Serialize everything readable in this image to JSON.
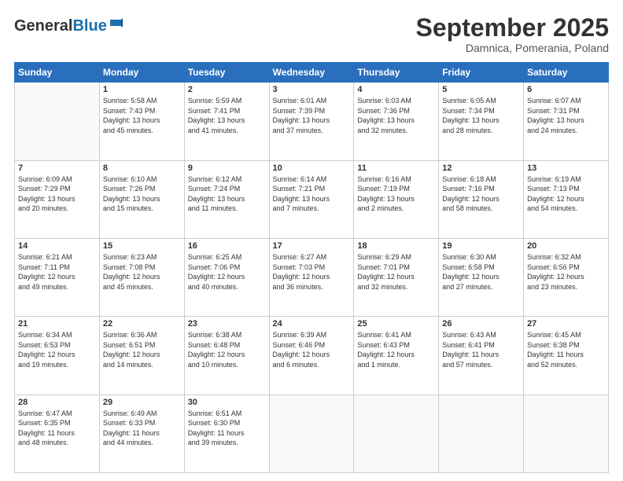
{
  "header": {
    "logo_general": "General",
    "logo_blue": "Blue",
    "month_title": "September 2025",
    "location": "Damnica, Pomerania, Poland"
  },
  "weekdays": [
    "Sunday",
    "Monday",
    "Tuesday",
    "Wednesday",
    "Thursday",
    "Friday",
    "Saturday"
  ],
  "weeks": [
    [
      {
        "day": "",
        "info": ""
      },
      {
        "day": "1",
        "info": "Sunrise: 5:58 AM\nSunset: 7:43 PM\nDaylight: 13 hours\nand 45 minutes."
      },
      {
        "day": "2",
        "info": "Sunrise: 5:59 AM\nSunset: 7:41 PM\nDaylight: 13 hours\nand 41 minutes."
      },
      {
        "day": "3",
        "info": "Sunrise: 6:01 AM\nSunset: 7:39 PM\nDaylight: 13 hours\nand 37 minutes."
      },
      {
        "day": "4",
        "info": "Sunrise: 6:03 AM\nSunset: 7:36 PM\nDaylight: 13 hours\nand 32 minutes."
      },
      {
        "day": "5",
        "info": "Sunrise: 6:05 AM\nSunset: 7:34 PM\nDaylight: 13 hours\nand 28 minutes."
      },
      {
        "day": "6",
        "info": "Sunrise: 6:07 AM\nSunset: 7:31 PM\nDaylight: 13 hours\nand 24 minutes."
      }
    ],
    [
      {
        "day": "7",
        "info": "Sunrise: 6:09 AM\nSunset: 7:29 PM\nDaylight: 13 hours\nand 20 minutes."
      },
      {
        "day": "8",
        "info": "Sunrise: 6:10 AM\nSunset: 7:26 PM\nDaylight: 13 hours\nand 15 minutes."
      },
      {
        "day": "9",
        "info": "Sunrise: 6:12 AM\nSunset: 7:24 PM\nDaylight: 13 hours\nand 11 minutes."
      },
      {
        "day": "10",
        "info": "Sunrise: 6:14 AM\nSunset: 7:21 PM\nDaylight: 13 hours\nand 7 minutes."
      },
      {
        "day": "11",
        "info": "Sunrise: 6:16 AM\nSunset: 7:19 PM\nDaylight: 13 hours\nand 2 minutes."
      },
      {
        "day": "12",
        "info": "Sunrise: 6:18 AM\nSunset: 7:16 PM\nDaylight: 12 hours\nand 58 minutes."
      },
      {
        "day": "13",
        "info": "Sunrise: 6:19 AM\nSunset: 7:13 PM\nDaylight: 12 hours\nand 54 minutes."
      }
    ],
    [
      {
        "day": "14",
        "info": "Sunrise: 6:21 AM\nSunset: 7:11 PM\nDaylight: 12 hours\nand 49 minutes."
      },
      {
        "day": "15",
        "info": "Sunrise: 6:23 AM\nSunset: 7:08 PM\nDaylight: 12 hours\nand 45 minutes."
      },
      {
        "day": "16",
        "info": "Sunrise: 6:25 AM\nSunset: 7:06 PM\nDaylight: 12 hours\nand 40 minutes."
      },
      {
        "day": "17",
        "info": "Sunrise: 6:27 AM\nSunset: 7:03 PM\nDaylight: 12 hours\nand 36 minutes."
      },
      {
        "day": "18",
        "info": "Sunrise: 6:29 AM\nSunset: 7:01 PM\nDaylight: 12 hours\nand 32 minutes."
      },
      {
        "day": "19",
        "info": "Sunrise: 6:30 AM\nSunset: 6:58 PM\nDaylight: 12 hours\nand 27 minutes."
      },
      {
        "day": "20",
        "info": "Sunrise: 6:32 AM\nSunset: 6:56 PM\nDaylight: 12 hours\nand 23 minutes."
      }
    ],
    [
      {
        "day": "21",
        "info": "Sunrise: 6:34 AM\nSunset: 6:53 PM\nDaylight: 12 hours\nand 19 minutes."
      },
      {
        "day": "22",
        "info": "Sunrise: 6:36 AM\nSunset: 6:51 PM\nDaylight: 12 hours\nand 14 minutes."
      },
      {
        "day": "23",
        "info": "Sunrise: 6:38 AM\nSunset: 6:48 PM\nDaylight: 12 hours\nand 10 minutes."
      },
      {
        "day": "24",
        "info": "Sunrise: 6:39 AM\nSunset: 6:46 PM\nDaylight: 12 hours\nand 6 minutes."
      },
      {
        "day": "25",
        "info": "Sunrise: 6:41 AM\nSunset: 6:43 PM\nDaylight: 12 hours\nand 1 minute."
      },
      {
        "day": "26",
        "info": "Sunrise: 6:43 AM\nSunset: 6:41 PM\nDaylight: 11 hours\nand 57 minutes."
      },
      {
        "day": "27",
        "info": "Sunrise: 6:45 AM\nSunset: 6:38 PM\nDaylight: 11 hours\nand 52 minutes."
      }
    ],
    [
      {
        "day": "28",
        "info": "Sunrise: 6:47 AM\nSunset: 6:35 PM\nDaylight: 11 hours\nand 48 minutes."
      },
      {
        "day": "29",
        "info": "Sunrise: 6:49 AM\nSunset: 6:33 PM\nDaylight: 11 hours\nand 44 minutes."
      },
      {
        "day": "30",
        "info": "Sunrise: 6:51 AM\nSunset: 6:30 PM\nDaylight: 11 hours\nand 39 minutes."
      },
      {
        "day": "",
        "info": ""
      },
      {
        "day": "",
        "info": ""
      },
      {
        "day": "",
        "info": ""
      },
      {
        "day": "",
        "info": ""
      }
    ]
  ]
}
